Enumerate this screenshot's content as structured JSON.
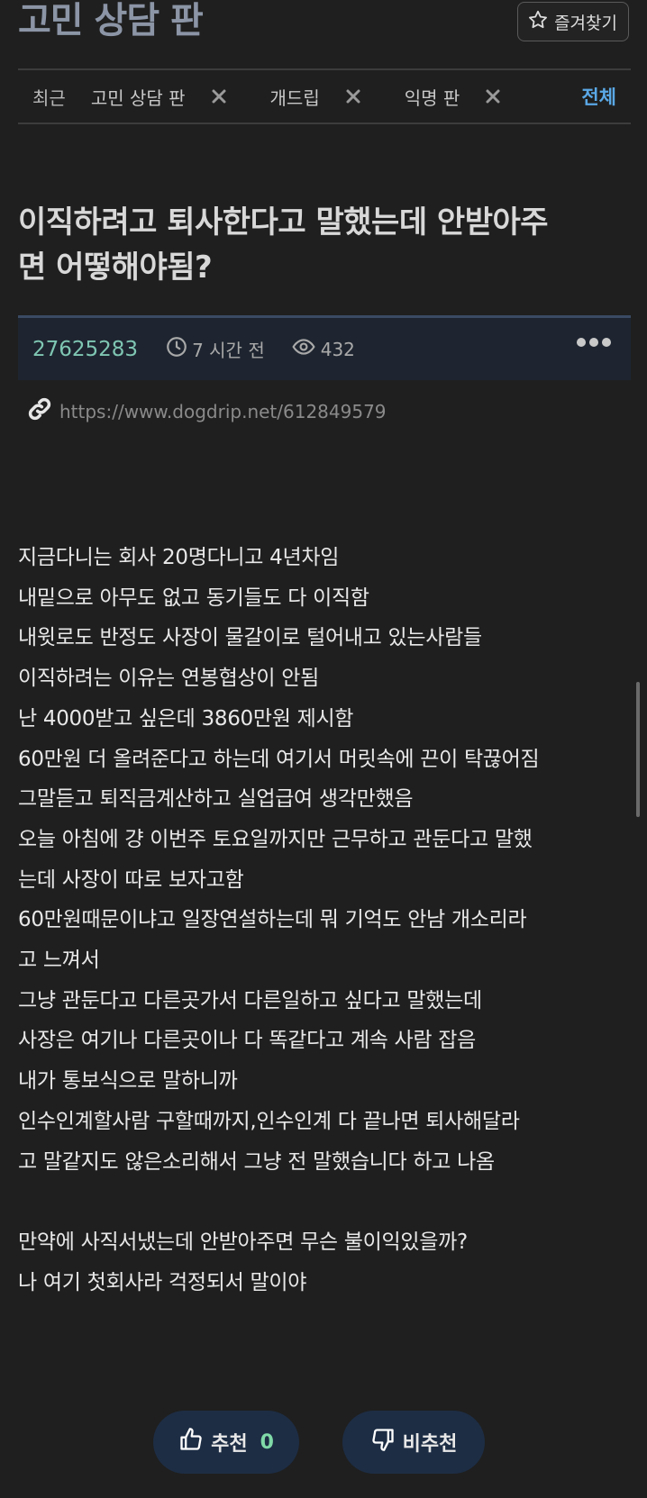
{
  "header": {
    "board_title": "고민 상담 판",
    "favorite_label": "즐겨찾기"
  },
  "tabs": {
    "recent_label": "최근",
    "items": [
      {
        "label": "고민 상담 판"
      },
      {
        "label": "개드립"
      },
      {
        "label": "익명 판"
      }
    ],
    "all_label": "전체"
  },
  "post": {
    "title_line1": "이직하려고 퇴사한다고 말했는데 안받아주",
    "title_line2": "면 어떻해야됨?",
    "id": "27625283",
    "time": "7 시간 전",
    "views": "432",
    "link": "https://www.dogdrip.net/612849579",
    "body": [
      "지금다니는 회사 20명다니고 4년차임",
      "내밑으로 아무도 없고 동기들도 다 이직함",
      "내윗로도 반정도 사장이 물갈이로 털어내고 있는사람들",
      "이직하려는 이유는 연봉협상이 안됨",
      "난 4000받고 싶은데 3860만원 제시함",
      "60만원 더 올려준다고 하는데 여기서 머릿속에 끈이 탁끊어짐",
      "그말듣고 퇴직금계산하고 실업급여 생각만했음",
      "오늘 아침에 걍 이번주 토요일까지만 근무하고 관둔다고 말했",
      "는데 사장이 따로 보자고함",
      "60만원때문이냐고 일장연설하는데 뭐 기억도 안남 개소리라",
      "고 느껴서",
      "그냥 관둔다고 다른곳가서 다른일하고 싶다고 말했는데",
      "사장은 여기나 다른곳이나 다 똑같다고 계속 사람 잡음",
      "내가 통보식으로 말하니까",
      "인수인계할사람 구할때까지,인수인계 다 끝나면 퇴사해달라",
      "고 말같지도 않은소리해서 그냥 전 말했습니다 하고 나옴",
      "",
      "만약에 사직서냈는데 안받아주면 무슨 불이익있을까?",
      "나 여기 첫회사라 걱정되서 말이야"
    ]
  },
  "vote": {
    "up_label": "추천",
    "up_count": "0",
    "down_label": "비추천"
  },
  "colors": {
    "background": "#1f1f1f",
    "board_title": "#8b95a6",
    "accent_blue": "#5aa8e6",
    "post_id": "#7fc6b3",
    "vote_bg": "#1d2d44",
    "vote_count": "#7fd9a8"
  }
}
